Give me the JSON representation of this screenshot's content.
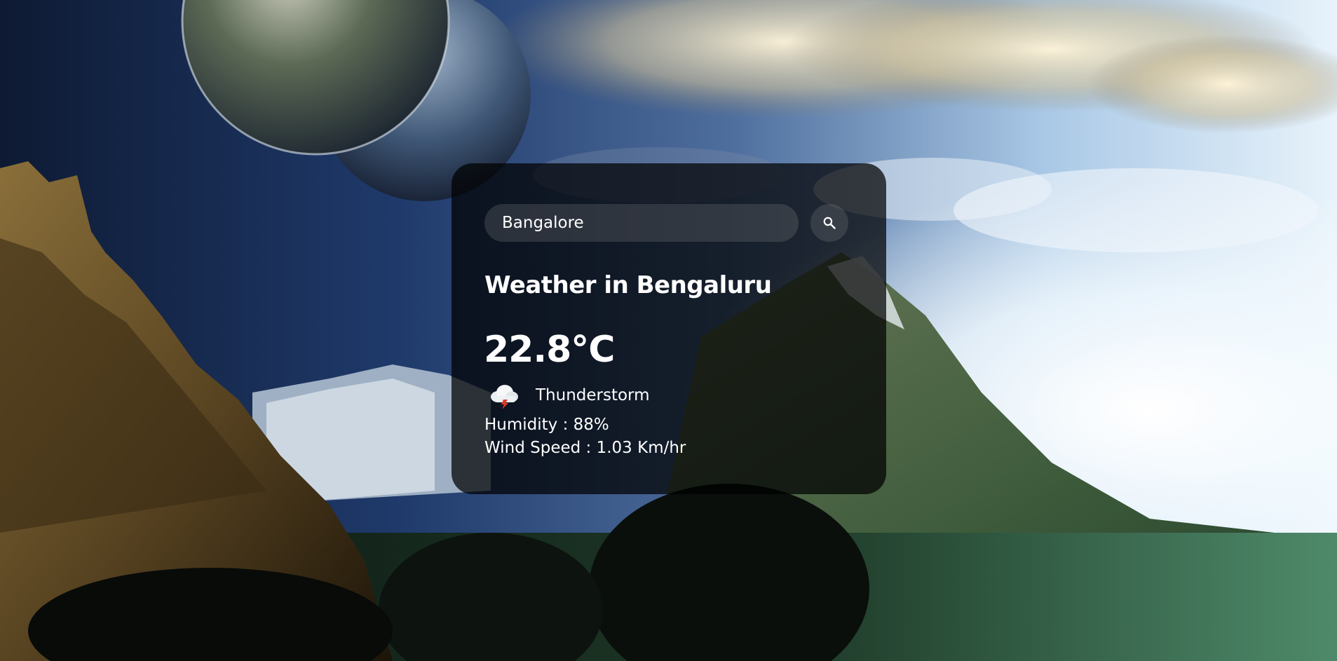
{
  "search": {
    "value": "Bangalore",
    "icon": "search-icon"
  },
  "weather": {
    "title": "Weather in Bengaluru",
    "temperature": "22.8°C",
    "condition_icon": "thunderstorm-cloud-icon",
    "description": "Thunderstorm",
    "humidity": "Humidity : 88%",
    "wind": "Wind Speed : 1.03 Km/hr"
  },
  "colors": {
    "text": "#ffffff",
    "card_background": "rgba(0,0,0,0.72)",
    "input_background": "rgba(125,125,125,0.28)"
  }
}
